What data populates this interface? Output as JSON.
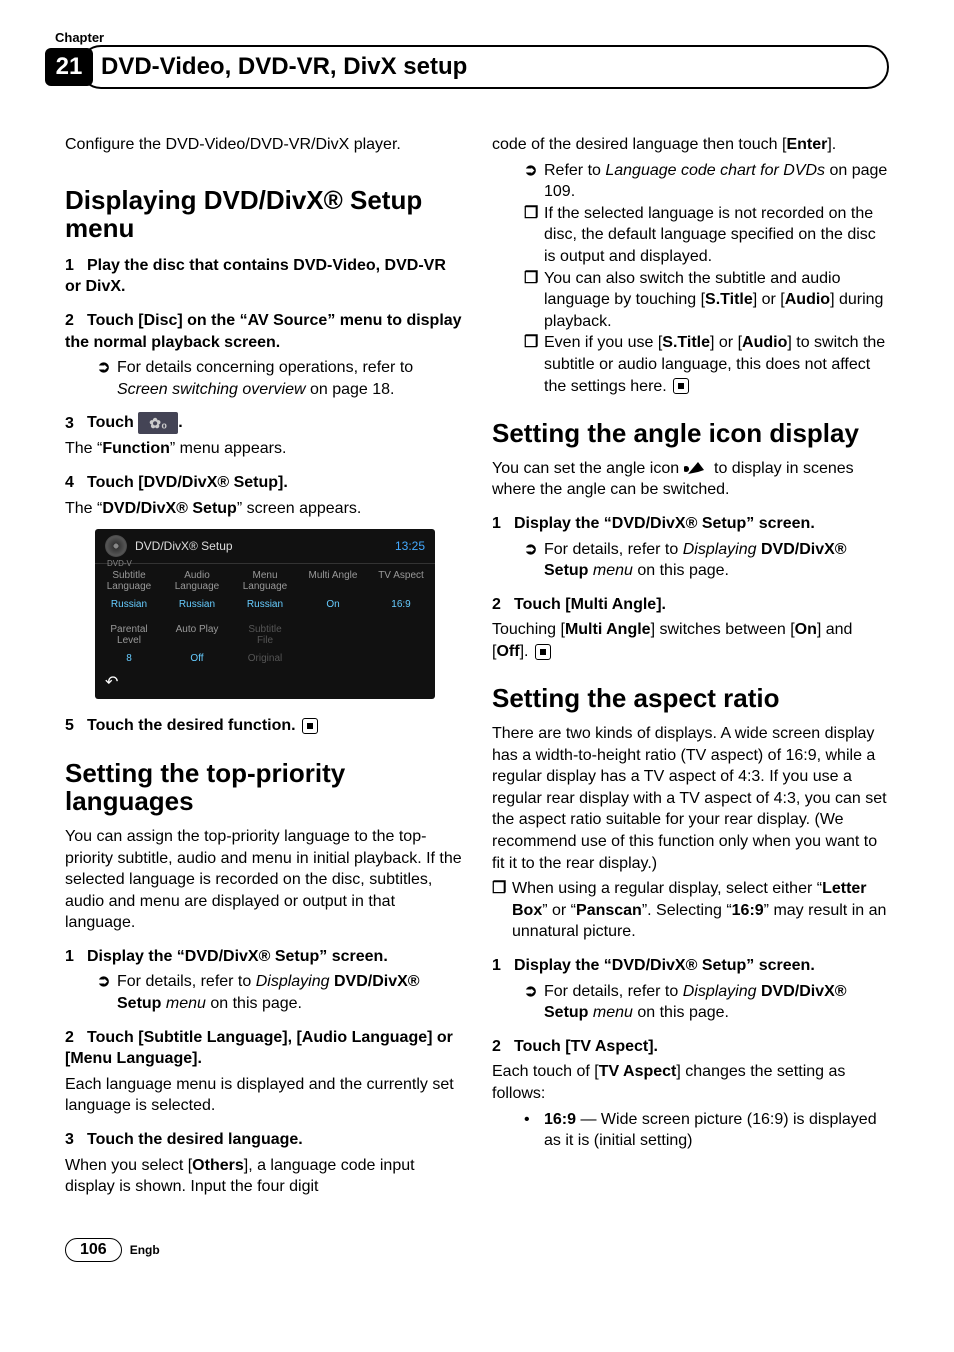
{
  "header": {
    "chapter_label": "Chapter",
    "chapter_number": "21",
    "chapter_title": "DVD-Video, DVD-VR, DivX setup"
  },
  "left": {
    "intro": "Configure the DVD-Video/DVD-VR/DivX player.",
    "h_displaying": "Displaying DVD/DivX® Setup menu",
    "s1": "Play the disc that contains DVD-Video, DVD-VR or DivX.",
    "s2a": "Touch [Disc] on the ",
    "s2b": "“AV Source”",
    "s2c": " menu to display the normal playback screen.",
    "s2_xref_a": "For details concerning operations, refer to ",
    "s2_xref_i": "Screen switching overview",
    "s2_xref_b": " on page 18.",
    "s3": "Touch ",
    "s3_dot": ".",
    "s3_after_a": "The “",
    "s3_after_b": "Function",
    "s3_after_c": "” menu appears.",
    "s4": "Touch [DVD/DivX® Setup].",
    "s4_after_a": "The “",
    "s4_after_b": "DVD/DivX® Setup",
    "s4_after_c": "” screen appears.",
    "s5": "Touch the desired function.",
    "h_toppriority": "Setting the top-priority languages",
    "tp_intro": "You can assign the top-priority language to the top-priority subtitle, audio and menu in initial playback. If the selected language is recorded on the disc, subtitles, audio and menu are displayed or output in that language.",
    "tp_s1": "Display the “DVD/DivX® Setup” screen.",
    "tp_s1_xref_a": "For details, refer to ",
    "tp_s1_xref_i1": "Displaying ",
    "tp_s1_xref_b1": "DVD/DivX® Setup",
    "tp_s1_xref_i2": " menu",
    "tp_s1_xref_b2": " on this page.",
    "tp_s2": "Touch [Subtitle Language], [Audio Language] or [Menu Language].",
    "tp_s2_after": "Each language menu is displayed and the currently set language is selected.",
    "tp_s3": "Touch the desired language.",
    "tp_s3_after_a": "When you select [",
    "tp_s3_after_b": "Others",
    "tp_s3_after_c": "], a language code input display is shown. Input the four digit"
  },
  "right": {
    "cont_a": "code of the desired language then touch [",
    "cont_b": "Enter",
    "cont_c": "].",
    "cont_x1_a": "Refer to ",
    "cont_x1_i": "Language code chart for DVDs",
    "cont_x1_b": " on page 109.",
    "cont_n1": "If the selected language is not recorded on the disc, the default language specified on the disc is output and displayed.",
    "cont_n2_a": "You can also switch the subtitle and audio language by touching [",
    "cont_n2_b": "S.Title",
    "cont_n2_c": "] or [",
    "cont_n2_d": "Audio",
    "cont_n2_e": "] during playback.",
    "cont_n3_a": "Even if you use [",
    "cont_n3_b": "S.Title",
    "cont_n3_c": "] or [",
    "cont_n3_d": "Audio",
    "cont_n3_e": "] to switch the subtitle or audio language, this does not affect the settings here.",
    "h_angle": "Setting the angle icon display",
    "angle_intro_a": "You can set the angle icon ",
    "angle_intro_b": " to display in scenes where the angle can be switched.",
    "angle_s1": "Display the “DVD/DivX® Setup” screen.",
    "angle_s1_xref_a": "For details, refer to ",
    "angle_s1_xref_i1": "Displaying ",
    "angle_s1_xref_b1": "DVD/DivX® Setup",
    "angle_s1_xref_i2": " menu",
    "angle_s1_xref_b2": " on this page.",
    "angle_s2": "Touch [Multi Angle].",
    "angle_s2_after_a": "Touching [",
    "angle_s2_after_b": "Multi Angle",
    "angle_s2_after_c": "] switches between [",
    "angle_s2_after_d": "On",
    "angle_s2_after_e": "] and [",
    "angle_s2_after_f": "Off",
    "angle_s2_after_g": "].",
    "h_aspect": "Setting the aspect ratio",
    "aspect_intro": "There are two kinds of displays. A wide screen display has a width-to-height ratio (TV aspect) of 16:9, while a regular display has a TV aspect of 4:3. If you use a regular rear display with a TV aspect of 4:3, you can set the aspect ratio suitable for your rear display. (We recommend use of this function only when you want to fit it to the rear display.)",
    "aspect_n1_a": "When using a regular display, select either “",
    "aspect_n1_b": "Letter Box",
    "aspect_n1_c": "” or “",
    "aspect_n1_d": "Panscan",
    "aspect_n1_e": "”. Selecting “",
    "aspect_n1_f": "16:9",
    "aspect_n1_g": "” may result in an unnatural picture.",
    "aspect_s1": "Display the “DVD/DivX® Setup” screen.",
    "aspect_s1_xref_a": "For details, refer to ",
    "aspect_s1_xref_i1": "Displaying ",
    "aspect_s1_xref_b1": "DVD/DivX® Setup",
    "aspect_s1_xref_i2": " menu",
    "aspect_s1_xref_b2": " on this page.",
    "aspect_s2": "Touch [TV Aspect].",
    "aspect_s2_after_a": "Each touch of [",
    "aspect_s2_after_b": "TV Aspect",
    "aspect_s2_after_c": "] changes the setting as follows:",
    "aspect_b1_a": "16:9",
    "aspect_b1_b": " — Wide screen picture (16:9) is displayed as it is (initial setting)"
  },
  "screenshot": {
    "title": "DVD/DivX® Setup",
    "time": "13:25",
    "cols": [
      {
        "h1": "Subtitle",
        "h2": "Language",
        "v": "Russian"
      },
      {
        "h1": "Audio",
        "h2": "Language",
        "v": "Russian"
      },
      {
        "h1": "Menu",
        "h2": "Language",
        "v": "Russian"
      },
      {
        "h1": "Multi Angle",
        "h2": "",
        "v": "On"
      },
      {
        "h1": "TV Aspect",
        "h2": "",
        "v": "16:9"
      }
    ],
    "row2": [
      {
        "h1": "Parental",
        "h2": "Level",
        "v": "8"
      },
      {
        "h1": "Auto Play",
        "h2": "",
        "v": "Off"
      },
      {
        "h1": "Subtitle",
        "h2": "File",
        "v": "Original",
        "dim": true
      }
    ],
    "source": "DVD-V"
  },
  "footer": {
    "page": "106",
    "lang": "Engb"
  }
}
